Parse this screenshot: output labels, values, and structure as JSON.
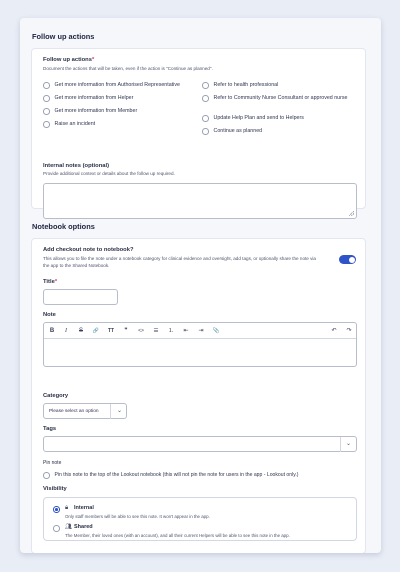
{
  "follow_up": {
    "section_title": "Follow up actions",
    "actions_label": "Follow up actions",
    "actions_required": "*",
    "actions_help": "Document the actions that will be taken, even if the action is \"Continue as planned\".",
    "options_left": [
      "Get more information from Authorised Representative",
      "Get more information from Helper",
      "Get more information from Member",
      "Raise an incident"
    ],
    "options_right": [
      "Refer to health professional",
      "Refer to Community Nurse Consultant or approved nurse",
      "Update Help Plan and send to Helpers",
      "Continue as planned"
    ],
    "notes_label": "Internal notes (optional)",
    "notes_help": "Provide additional context or details about the follow up required.",
    "notes_value": ""
  },
  "notebook": {
    "section_title": "Notebook options",
    "checkout_label": "Add checkout note to notebook?",
    "checkout_help": "This allows you to file the note under a notebook category for clinical evidence and oversight, add tags, or optionally share the note via the app to the Shared Notebook.",
    "checkout_enabled": true,
    "title_label": "Title",
    "title_required": "*",
    "title_value": "",
    "note_label": "Note",
    "toolbar": {
      "bold": "B",
      "italic": "I",
      "strike": "S",
      "link": "🔗",
      "heading": "TT",
      "quote": "❞",
      "code": "<>",
      "bullets": "☰",
      "numbers": "⒈",
      "outdent": "⇤",
      "indent": "⇥",
      "attach": "📎",
      "undo": "↶",
      "redo": "↷"
    },
    "category_label": "Category",
    "category_placeholder": "Please select an option",
    "tags_label": "Tags",
    "pin_label": "Pin note",
    "pin_text": "Pin this note to the top of the Lookout notebook (this will not pin the note for users in the app - Lookout only.)",
    "visibility_label": "Visibility",
    "visibility_options": [
      {
        "title": "Internal",
        "desc": "Only staff members will be able to see this note. It won't appear in the app.",
        "selected": true
      },
      {
        "title": "Shared",
        "desc": "The Member, their loved ones (with an account), and all their current Helpers will be able to see this note in the app.",
        "selected": false
      }
    ]
  },
  "colors": {
    "accent": "#2f54c9",
    "required": "#d6336c",
    "background": "#e9edf6"
  }
}
